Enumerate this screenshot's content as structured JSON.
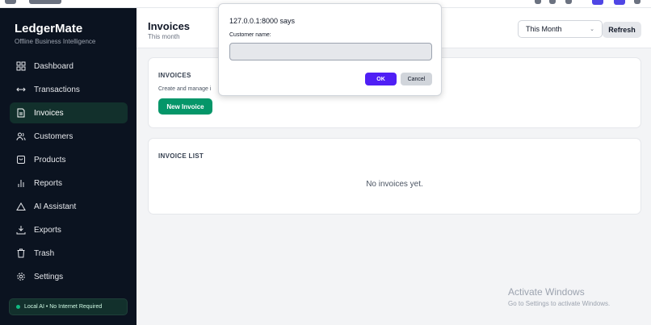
{
  "brand": {
    "title": "LedgerMate",
    "subtitle": "Offline Business Intelligence"
  },
  "sidebar": {
    "items": [
      {
        "label": "Dashboard",
        "icon": "grid-icon"
      },
      {
        "label": "Transactions",
        "icon": "arrows-horizontal-icon"
      },
      {
        "label": "Invoices",
        "icon": "document-icon",
        "active": true
      },
      {
        "label": "Customers",
        "icon": "users-icon"
      },
      {
        "label": "Products",
        "icon": "box-icon"
      },
      {
        "label": "Reports",
        "icon": "bar-chart-icon"
      },
      {
        "label": "AI Assistant",
        "icon": "cloud-icon"
      },
      {
        "label": "Exports",
        "icon": "download-icon"
      },
      {
        "label": "Trash",
        "icon": "trash-icon"
      },
      {
        "label": "Settings",
        "icon": "gear-icon"
      }
    ],
    "status": "Local AI • No Internet Required"
  },
  "header": {
    "title": "Invoices",
    "subtitle": "This month",
    "period_value": "This Month",
    "refresh_label": "Refresh"
  },
  "invoices_card": {
    "title": "INVOICES",
    "description": "Create and manage i",
    "new_button": "New Invoice"
  },
  "list_card": {
    "title": "INVOICE LIST",
    "empty_text": "No invoices yet."
  },
  "dialog": {
    "origin": "127.0.0.1:8000 says",
    "prompt": "Customer name:",
    "input_value": "",
    "ok_label": "OK",
    "cancel_label": "Cancel"
  },
  "watermark": {
    "line1": "Activate Windows",
    "line2": "Go to Settings to activate Windows."
  },
  "colors": {
    "sidebar_bg": "#0b1320",
    "active_bg": "#12302c",
    "accent_green": "#059669",
    "dialog_ok": "#4f1ff5"
  }
}
